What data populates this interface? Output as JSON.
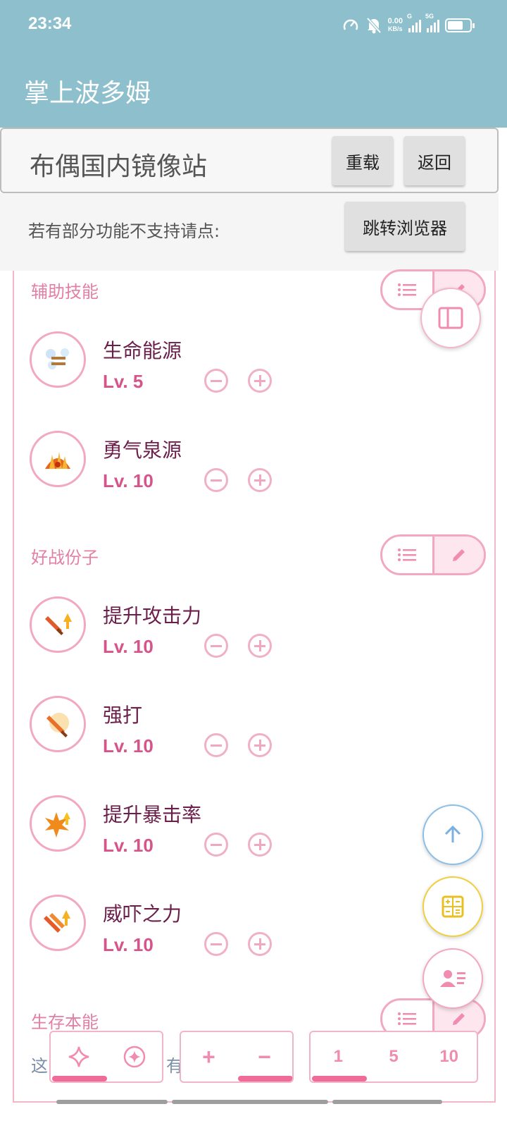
{
  "status_bar": {
    "time": "23:34",
    "net_speed_value": "0.00",
    "net_speed_unit": "KB/s",
    "signal1_label": "G",
    "signal2_label": "5G"
  },
  "app": {
    "title": "掌上波多姆"
  },
  "mirror_bar": {
    "title": "布偶国内镜像站",
    "reload_label": "重载",
    "back_label": "返回",
    "notice": "若有部分功能不支持请点:",
    "open_browser_label": "跳转浏览器"
  },
  "sections": [
    {
      "title": "辅助技能",
      "skills": [
        {
          "name": "生命能源",
          "level": "Lv. 5",
          "icon": "life-energy-icon"
        },
        {
          "name": "勇气泉源",
          "level": "Lv. 10",
          "icon": "courage-fountain-icon"
        }
      ]
    },
    {
      "title": "好战份子",
      "skills": [
        {
          "name": "提升攻击力",
          "level": "Lv. 10",
          "icon": "attack-up-icon"
        },
        {
          "name": "强打",
          "level": "Lv. 10",
          "icon": "power-strike-icon"
        },
        {
          "name": "提升暴击率",
          "level": "Lv. 10",
          "icon": "crit-up-icon"
        },
        {
          "name": "威吓之力",
          "level": "Lv. 10",
          "icon": "intimidate-icon"
        }
      ]
    },
    {
      "title": "生存本能"
    }
  ],
  "bottom_hint": {
    "start": "这",
    "end": "有"
  },
  "toolbar": {
    "mode_group": [
      "sparkle-icon",
      "compass-icon"
    ],
    "step_group": [
      "+",
      "−"
    ],
    "amount_group": [
      "1",
      "5",
      "10"
    ]
  },
  "colors": {
    "app_bar": "#8dbfcd",
    "accent_pink": "#f06c98",
    "skill_name": "#6b1e4a",
    "level_text": "#d6548a",
    "fab_up": "#8bbfe6",
    "fab_calc": "#f0d040",
    "fab_profile": "#f08cb0"
  }
}
